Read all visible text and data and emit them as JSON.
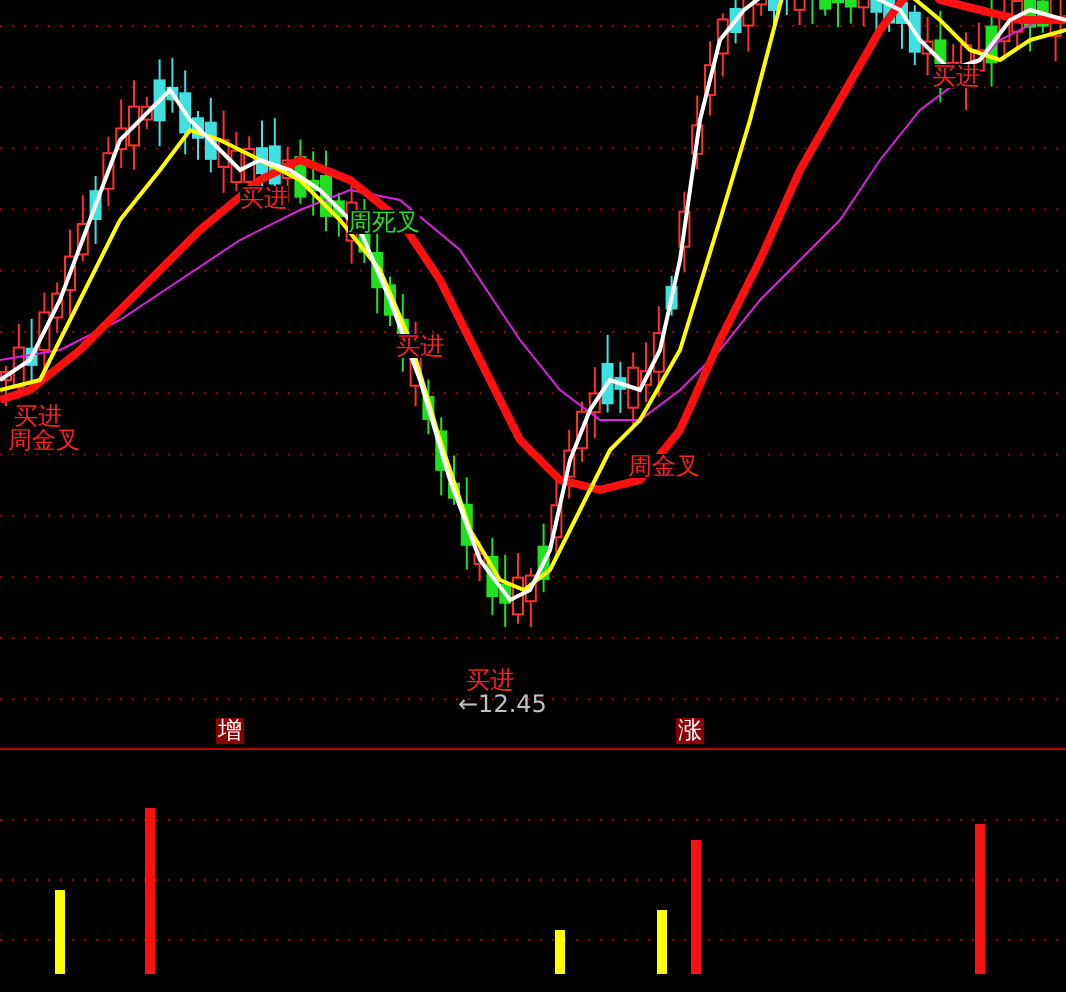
{
  "price_chart": {
    "signals": [
      {
        "text": "买进",
        "kind": "buy"
      },
      {
        "text": "周金叉",
        "kind": "golden_cross"
      },
      {
        "text": "买进",
        "kind": "buy"
      },
      {
        "text": "周死叉",
        "kind": "death_cross"
      },
      {
        "text": "买进",
        "kind": "buy"
      },
      {
        "text": "买进",
        "kind": "buy"
      },
      {
        "text": "周金叉",
        "kind": "golden_cross"
      },
      {
        "text": "买进",
        "kind": "buy"
      }
    ],
    "low_price_note": "←12.45"
  },
  "indicator_labels": [
    "增",
    "涨"
  ]
}
